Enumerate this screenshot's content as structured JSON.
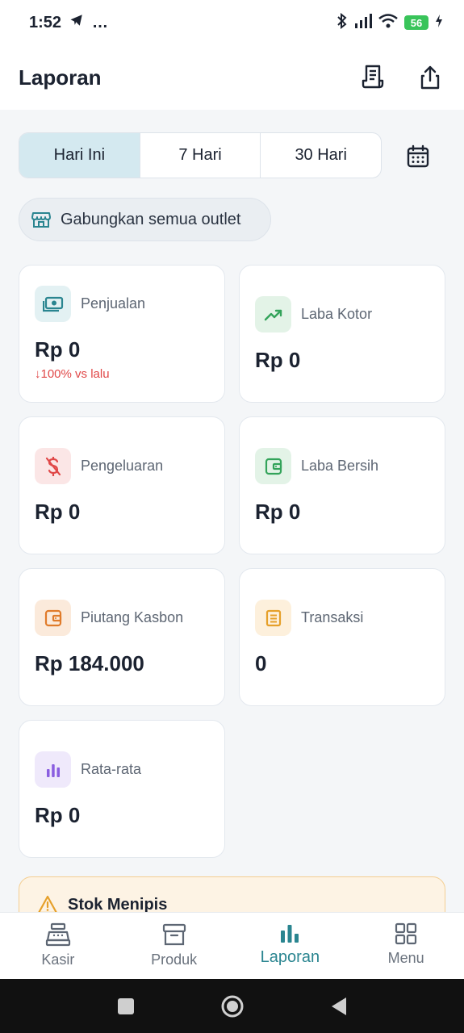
{
  "status_bar": {
    "time": "1:52",
    "dots": "…",
    "battery": "56"
  },
  "header": {
    "title": "Laporan"
  },
  "period_tabs": [
    {
      "label": "Hari Ini",
      "active": true
    },
    {
      "label": "7 Hari",
      "active": false
    },
    {
      "label": "30 Hari",
      "active": false
    }
  ],
  "outlet_filter": {
    "label": "Gabungkan semua outlet"
  },
  "cards": {
    "penjualan": {
      "label": "Penjualan",
      "value": "Rp 0",
      "delta": "100% vs lalu",
      "icon": "cash-icon",
      "icon_bg": "#e3f1f3",
      "icon_color": "#2a8590"
    },
    "laba_kotor": {
      "label": "Laba Kotor",
      "value": "Rp 0",
      "icon": "trending-up-icon",
      "icon_bg": "#e3f3e7",
      "icon_color": "#33a35a"
    },
    "pengeluaran": {
      "label": "Pengeluaran",
      "value": "Rp 0",
      "icon": "dollar-off-icon",
      "icon_bg": "#fbe6e6",
      "icon_color": "#e04848"
    },
    "laba_bersih": {
      "label": "Laba Bersih",
      "value": "Rp 0",
      "icon": "wallet-icon",
      "icon_bg": "#e3f3e7",
      "icon_color": "#33a35a"
    },
    "piutang": {
      "label": "Piutang Kasbon",
      "value": "Rp 184.000",
      "icon": "wallet-icon",
      "icon_bg": "#fbeadb",
      "icon_color": "#e07b2a"
    },
    "transaksi": {
      "label": "Transaksi",
      "value": "0",
      "icon": "receipt-list-icon",
      "icon_bg": "#fdf0dc",
      "icon_color": "#e6a02a"
    },
    "rata_rata": {
      "label": "Rata-rata",
      "value": "Rp 0",
      "icon": "bar-chart-icon",
      "icon_bg": "#efe9fb",
      "icon_color": "#8a5ee0"
    }
  },
  "stock_alert": {
    "title": "Stok Menipis",
    "icon": "warning-icon",
    "color": "#e6a02a"
  },
  "bottom_nav": [
    {
      "label": "Kasir",
      "icon": "cash-register-icon"
    },
    {
      "label": "Produk",
      "icon": "box-icon"
    },
    {
      "label": "Laporan",
      "icon": "bar-chart-icon",
      "active": true
    },
    {
      "label": "Menu",
      "icon": "grid-icon"
    }
  ],
  "colors": {
    "accent": "#2a8590",
    "active_tab_bg": "#d4e9f0",
    "negative": "#e04848"
  }
}
